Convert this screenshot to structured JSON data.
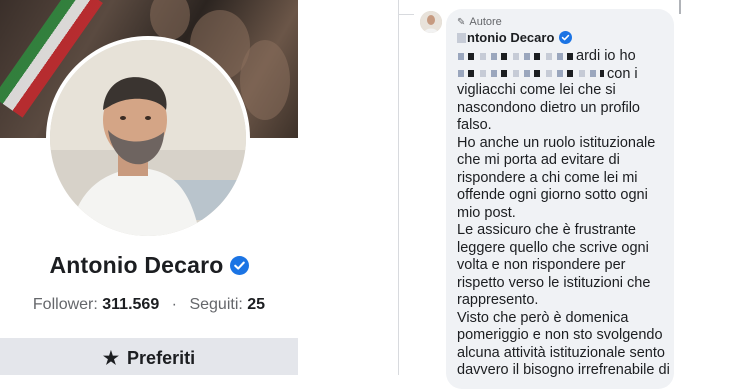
{
  "profile": {
    "name": "Antonio Decaro",
    "followers_label": "Follower:",
    "followers_value": "311.569",
    "separator": "·",
    "following_label": "Seguiti:",
    "following_value": "25",
    "favorites_button": "Preferiti",
    "verified_icon": "verified-badge-icon",
    "star_icon": "star-icon"
  },
  "comment": {
    "badge": "Autore",
    "badge_icon": "pencil-icon",
    "author_visible": "ntonio Decaro",
    "line1_tail": "ardi io ho",
    "line2_tail": "con i",
    "body": "vigliacchi come lei che si nascondono dietro un profilo falso.\nHo anche un ruolo istituzionale che mi porta ad evitare di rispondere a chi come lei mi offende ogni giorno sotto ogni mio post.\nLe assicuro che è frustrante leggere quello che scrive ogni volta e non rispondere per rispetto verso le istituzioni che rappresento.\nVisto che però è domenica pomeriggio e non sto svolgendo alcuna attività istituzionale sento davvero il bisogno irrefrenabile di"
  },
  "colors": {
    "verified_blue": "#1b74e4",
    "text_primary": "#1c1e21",
    "text_secondary": "#65676b",
    "button_bg": "#e4e6eb",
    "bubble_bg": "#f0f2f5"
  }
}
